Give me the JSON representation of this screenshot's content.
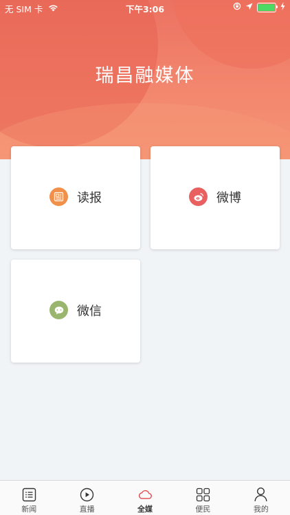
{
  "status_bar": {
    "carrier": "无 SIM 卡",
    "time": "下午3:06"
  },
  "header": {
    "title": "瑞昌融媒体"
  },
  "cards": [
    {
      "label": "读报",
      "icon": "newspaper-icon",
      "color": "#f0904a"
    },
    {
      "label": "微博",
      "icon": "weibo-icon",
      "color": "#e96060"
    },
    {
      "label": "微信",
      "icon": "wechat-icon",
      "color": "#9ab66e"
    }
  ],
  "tabbar": {
    "items": [
      {
        "label": "新闻",
        "icon": "news-list-icon"
      },
      {
        "label": "直播",
        "icon": "play-icon"
      },
      {
        "label": "全媒",
        "icon": "cloud-icon",
        "active": true
      },
      {
        "label": "便民",
        "icon": "grid-icon"
      },
      {
        "label": "我的",
        "icon": "user-icon"
      }
    ]
  },
  "colors": {
    "header_gradient_top": "#ec7261",
    "header_gradient_bottom": "#f49474",
    "active_tab": "#e0464a",
    "battery": "#4cd964"
  }
}
